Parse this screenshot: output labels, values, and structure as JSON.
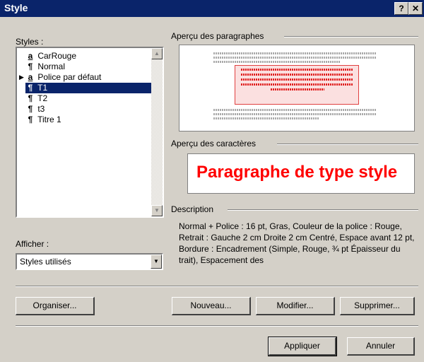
{
  "title": "Style",
  "titlebar": {
    "help_label": "?",
    "close_label": "✕"
  },
  "styles_label": "Styles :",
  "styles_list": [
    {
      "glyph": "a",
      "label": "CarRouge",
      "selected": false,
      "arrow": false
    },
    {
      "glyph": "¶",
      "label": "Normal",
      "selected": false,
      "arrow": false
    },
    {
      "glyph": "a",
      "label": "Police par défaut",
      "selected": false,
      "arrow": true
    },
    {
      "glyph": "¶",
      "label": "T1",
      "selected": true,
      "arrow": true
    },
    {
      "glyph": "¶",
      "label": "T2",
      "selected": false,
      "arrow": false
    },
    {
      "glyph": "¶",
      "label": "t3",
      "selected": false,
      "arrow": false
    },
    {
      "glyph": "¶",
      "label": "Titre 1",
      "selected": false,
      "arrow": false
    }
  ],
  "show_label": "Afficher :",
  "show_value": "Styles utilisés",
  "paragraph_preview_label": "Aperçu des paragraphes",
  "character_preview_label": "Aperçu des caractères",
  "character_preview_text": "Paragraphe de type style",
  "description_label": "Description",
  "description_text": "Normal + Police : 16 pt, Gras, Couleur de la police : Rouge, Retrait : Gauche 2 cm Droite 2 cm Centré, Espace avant 12 pt, Bordure : Encadrement (Simple, Rouge, ¾ pt Épaisseur du trait), Espacement des",
  "buttons": {
    "organize": "Organiser...",
    "new": "Nouveau...",
    "modify": "Modifier...",
    "delete": "Supprimer...",
    "apply": "Appliquer",
    "cancel": "Annuler"
  },
  "colors": {
    "titlebar": "#0a246a",
    "selection": "#0a246a",
    "preview_red": "#ff0000"
  }
}
